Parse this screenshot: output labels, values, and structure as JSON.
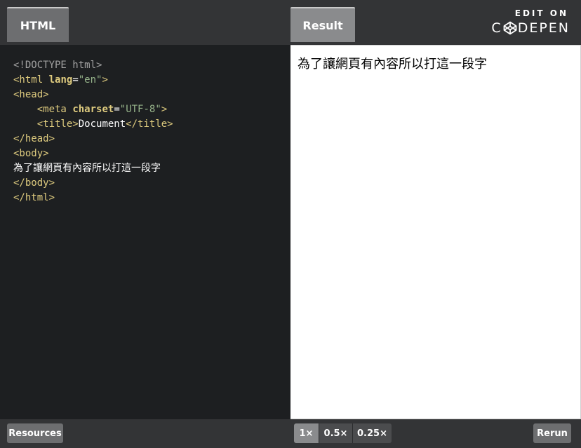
{
  "tabs": {
    "html_label": "HTML",
    "result_label": "Result"
  },
  "codepen_link": {
    "edit_on": "EDIT ON",
    "brand_prefix": "C",
    "brand_suffix": "DEPEN",
    "logo_icon": "codepen-cube-icon"
  },
  "code": {
    "doctype": "<!DOCTYPE html>",
    "html_open_tag": "<html",
    "html_lang_attr": "lang",
    "html_lang_eq": "=",
    "html_lang_value": "\"en\"",
    "html_open_close": ">",
    "head_open": "<head>",
    "meta_open": "<meta",
    "meta_charset_attr": "charset",
    "meta_eq": "=",
    "meta_charset_value": "\"UTF-8\"",
    "meta_close": ">",
    "title_open": "<title>",
    "title_text": "Document",
    "title_close": "</title>",
    "head_close": "</head>",
    "body_open": "<body>",
    "body_text": "為了讓網頁有內容所以打這一段字",
    "body_close": "</body>",
    "html_close": "</html>"
  },
  "result": {
    "text": "為了讓網頁有內容所以打這一段字"
  },
  "bottom_bar": {
    "resources_label": "Resources",
    "zoom_options": [
      "1×",
      "0.5×",
      "0.25×"
    ],
    "zoom_selected": "1×",
    "rerun_label": "Rerun"
  },
  "colors": {
    "editor_bg": "#1d1f21",
    "bar_bg": "#333436",
    "tag": "#ddca7e",
    "attr_value": "#96b38a",
    "doctype": "#a1a1a1"
  }
}
